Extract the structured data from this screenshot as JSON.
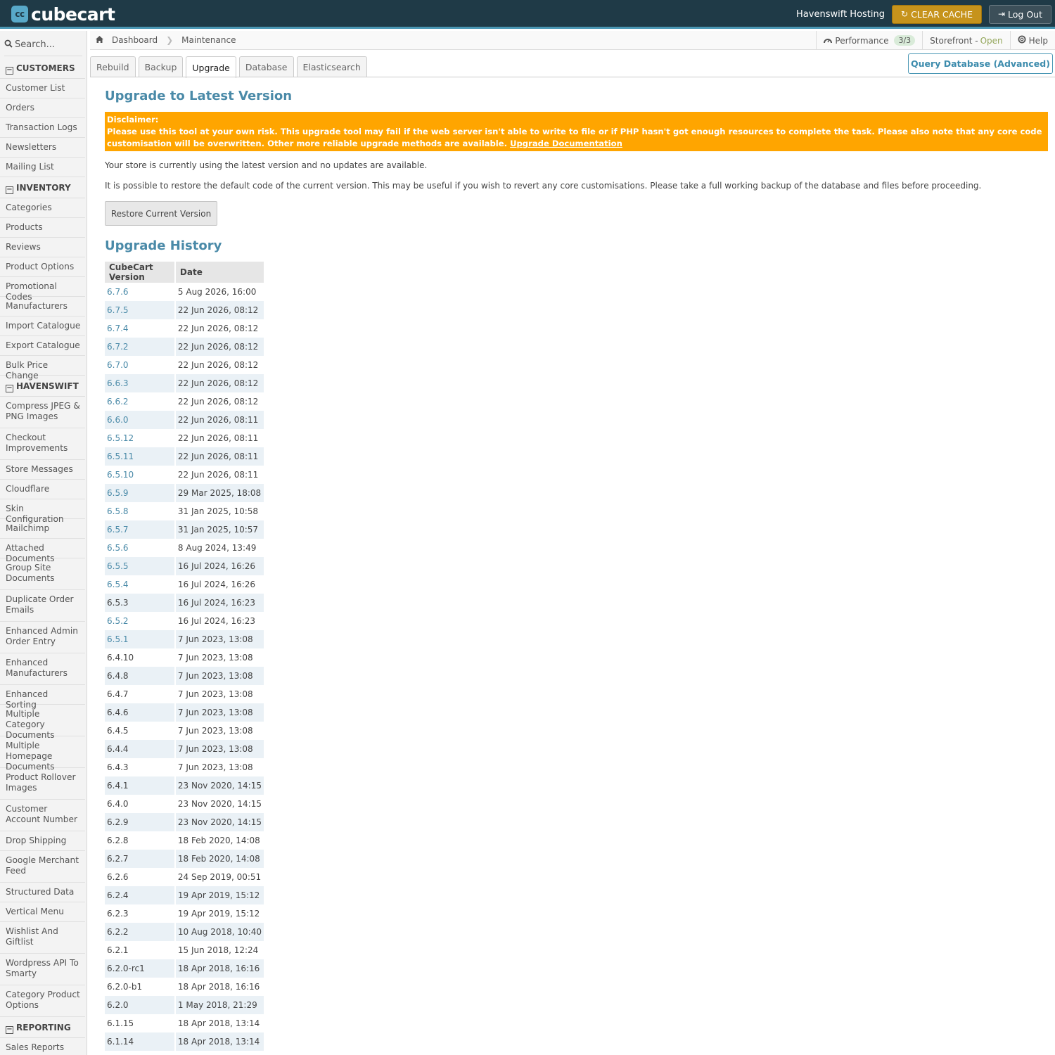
{
  "app": {
    "logo_text": "cubecart",
    "logo_mark": "cc",
    "hosting_label": "Havenswift Hosting",
    "clear_cache_label": "CLEAR CACHE",
    "logout_label": "Log Out"
  },
  "colors": {
    "header_bg": "#1f3a47",
    "accent": "#4a97b4",
    "disclaimer_bg": "#ffa500",
    "cache_button": "#c6931c"
  },
  "icons": {
    "search": "search-icon",
    "refresh": "refresh-icon",
    "logout": "logout-icon",
    "home": "home-icon",
    "performance": "gauge-icon",
    "help": "help-icon",
    "collapse": "collapse-icon"
  },
  "sidebar": {
    "search_placeholder": "Search...",
    "sections": [
      {
        "title": "CUSTOMERS",
        "items": [
          "Customer List",
          "Orders",
          "Transaction Logs",
          "Newsletters",
          "Mailing List"
        ]
      },
      {
        "title": "INVENTORY",
        "items": [
          "Categories",
          "Products",
          "Reviews",
          "Product Options",
          "Promotional Codes",
          "Manufacturers",
          "Import Catalogue",
          "Export Catalogue",
          "Bulk Price Change"
        ]
      },
      {
        "title": "HAVENSWIFT",
        "items": [
          "Compress JPEG & PNG Images",
          "Checkout Improvements",
          "Store Messages",
          "Cloudflare",
          "Skin Configuration",
          "Mailchimp",
          "Attached Documents",
          "Group Site Documents",
          "Duplicate Order Emails",
          "Enhanced Admin Order Entry",
          "Enhanced Manufacturers",
          "Enhanced Sorting",
          "Multiple Category Documents",
          "Multiple Homepage Documents",
          "Product Rollover Images",
          "Customer Account Number",
          "Drop Shipping",
          "Google Merchant Feed",
          "Structured Data",
          "Vertical Menu",
          "Wishlist And Giftlist",
          "Wordpress API To Smarty",
          "Category Product Options"
        ]
      },
      {
        "title": "REPORTING",
        "items": [
          "Sales Reports"
        ]
      }
    ]
  },
  "breadcrumb": {
    "items": [
      "Dashboard",
      "Maintenance"
    ]
  },
  "status": {
    "performance_label": "Performance",
    "performance_badge": "3/3",
    "storefront_label": "Storefront -",
    "storefront_state": "Open",
    "help_label": "Help"
  },
  "tabs": [
    "Rebuild",
    "Backup",
    "Upgrade",
    "Database",
    "Elasticsearch"
  ],
  "active_tab": "Upgrade",
  "query_button_label": "Query Database (Advanced)",
  "upgrade": {
    "title": "Upgrade to Latest Version",
    "disclaimer_heading": "Disclaimer:",
    "disclaimer_text": "Please use this tool at your own risk. This upgrade tool may fail if the web server isn't able to write to file or if PHP hasn't got enough resources to complete the task. Please also note that any core code customisation will be overwritten. Other more reliable upgrade methods are available. ",
    "disclaimer_link": "Upgrade Documentation",
    "status_text": "Your store is currently using the latest version and no updates are available.",
    "restore_text": "It is possible to restore the default code of the current version. This may be useful if you wish to revert any core customisations. Please take a full working backup of the database and files before proceeding.",
    "restore_button": "Restore Current Version"
  },
  "history": {
    "title": "Upgrade History",
    "columns": [
      "CubeCart Version",
      "Date"
    ],
    "rows": [
      {
        "version": "6.7.6",
        "date": "5 Aug 2026, 16:00",
        "link": true
      },
      {
        "version": "6.7.5",
        "date": "22 Jun 2026, 08:12",
        "link": true
      },
      {
        "version": "6.7.4",
        "date": "22 Jun 2026, 08:12",
        "link": true
      },
      {
        "version": "6.7.2",
        "date": "22 Jun 2026, 08:12",
        "link": true
      },
      {
        "version": "6.7.0",
        "date": "22 Jun 2026, 08:12",
        "link": true
      },
      {
        "version": "6.6.3",
        "date": "22 Jun 2026, 08:12",
        "link": true
      },
      {
        "version": "6.6.2",
        "date": "22 Jun 2026, 08:12",
        "link": true
      },
      {
        "version": "6.6.0",
        "date": "22 Jun 2026, 08:11",
        "link": true
      },
      {
        "version": "6.5.12",
        "date": "22 Jun 2026, 08:11",
        "link": true
      },
      {
        "version": "6.5.11",
        "date": "22 Jun 2026, 08:11",
        "link": true
      },
      {
        "version": "6.5.10",
        "date": "22 Jun 2026, 08:11",
        "link": true
      },
      {
        "version": "6.5.9",
        "date": "29 Mar 2025, 18:08",
        "link": true
      },
      {
        "version": "6.5.8",
        "date": "31 Jan 2025, 10:58",
        "link": true
      },
      {
        "version": "6.5.7",
        "date": "31 Jan 2025, 10:57",
        "link": true
      },
      {
        "version": "6.5.6",
        "date": "8 Aug 2024, 13:49",
        "link": true
      },
      {
        "version": "6.5.5",
        "date": "16 Jul 2024, 16:26",
        "link": true
      },
      {
        "version": "6.5.4",
        "date": "16 Jul 2024, 16:26",
        "link": true
      },
      {
        "version": "6.5.3",
        "date": "16 Jul 2024, 16:23",
        "link": false
      },
      {
        "version": "6.5.2",
        "date": "16 Jul 2024, 16:23",
        "link": true
      },
      {
        "version": "6.5.1",
        "date": "7 Jun 2023, 13:08",
        "link": true
      },
      {
        "version": "6.4.10",
        "date": "7 Jun 2023, 13:08",
        "link": false
      },
      {
        "version": "6.4.8",
        "date": "7 Jun 2023, 13:08",
        "link": false
      },
      {
        "version": "6.4.7",
        "date": "7 Jun 2023, 13:08",
        "link": false
      },
      {
        "version": "6.4.6",
        "date": "7 Jun 2023, 13:08",
        "link": false
      },
      {
        "version": "6.4.5",
        "date": "7 Jun 2023, 13:08",
        "link": false
      },
      {
        "version": "6.4.4",
        "date": "7 Jun 2023, 13:08",
        "link": false
      },
      {
        "version": "6.4.3",
        "date": "7 Jun 2023, 13:08",
        "link": false
      },
      {
        "version": "6.4.1",
        "date": "23 Nov 2020, 14:15",
        "link": false
      },
      {
        "version": "6.4.0",
        "date": "23 Nov 2020, 14:15",
        "link": false
      },
      {
        "version": "6.2.9",
        "date": "23 Nov 2020, 14:15",
        "link": false
      },
      {
        "version": "6.2.8",
        "date": "18 Feb 2020, 14:08",
        "link": false
      },
      {
        "version": "6.2.7",
        "date": "18 Feb 2020, 14:08",
        "link": false
      },
      {
        "version": "6.2.6",
        "date": "24 Sep 2019, 00:51",
        "link": false
      },
      {
        "version": "6.2.4",
        "date": "19 Apr 2019, 15:12",
        "link": false
      },
      {
        "version": "6.2.3",
        "date": "19 Apr 2019, 15:12",
        "link": false
      },
      {
        "version": "6.2.2",
        "date": "10 Aug 2018, 10:40",
        "link": false
      },
      {
        "version": "6.2.1",
        "date": "15 Jun 2018, 12:24",
        "link": false
      },
      {
        "version": "6.2.0-rc1",
        "date": "18 Apr 2018, 16:16",
        "link": false
      },
      {
        "version": "6.2.0-b1",
        "date": "18 Apr 2018, 16:16",
        "link": false
      },
      {
        "version": "6.2.0",
        "date": "1 May 2018, 21:29",
        "link": false
      },
      {
        "version": "6.1.15",
        "date": "18 Apr 2018, 13:14",
        "link": false
      },
      {
        "version": "6.1.14",
        "date": "18 Apr 2018, 13:14",
        "link": false
      }
    ]
  }
}
